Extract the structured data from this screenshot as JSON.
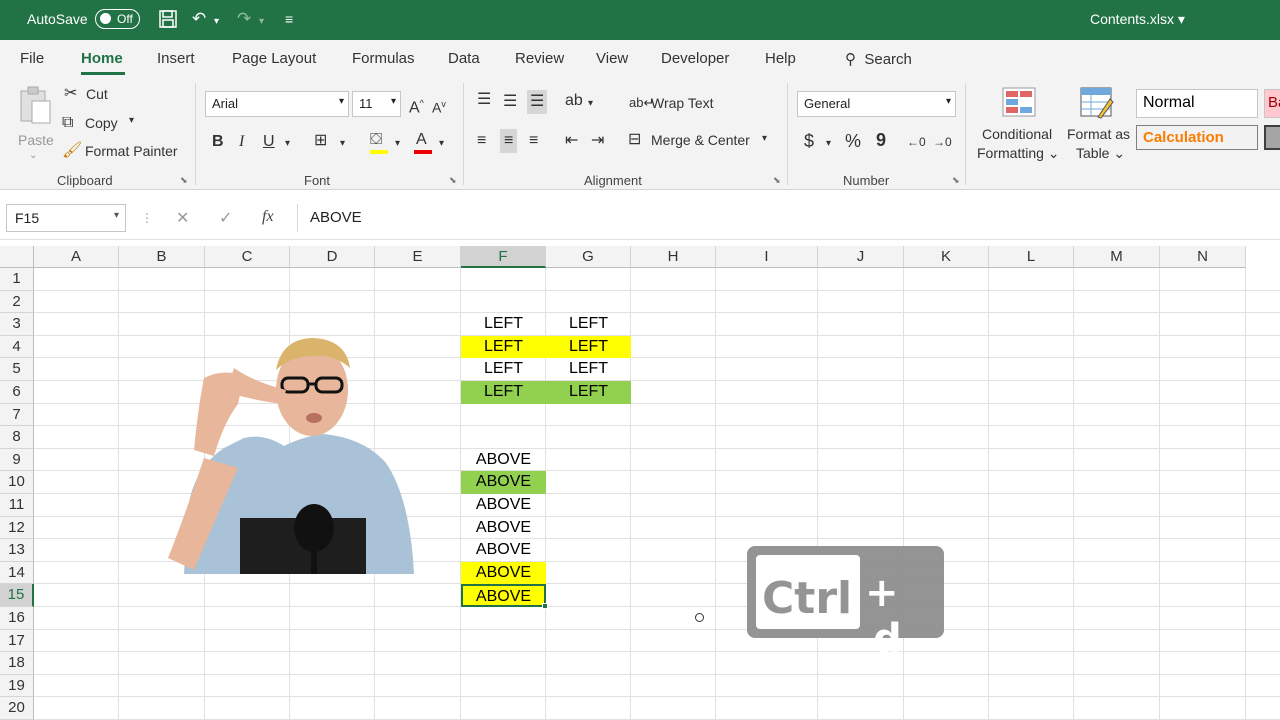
{
  "titlebar": {
    "autosave_label": "AutoSave",
    "toggle_state": "Off",
    "filename": "Contents.xlsx"
  },
  "menu": {
    "items": [
      "File",
      "Home",
      "Insert",
      "Page Layout",
      "Formulas",
      "Data",
      "Review",
      "View",
      "Developer",
      "Help"
    ],
    "search": "Search",
    "active": "Home"
  },
  "ribbon": {
    "clipboard": {
      "paste": "Paste",
      "cut": "Cut",
      "copy": "Copy",
      "format_painter": "Format Painter",
      "label": "Clipboard"
    },
    "font": {
      "name": "Arial",
      "size": "11",
      "bold": "B",
      "italic": "I",
      "underline": "U",
      "label": "Font"
    },
    "alignment": {
      "wrap_text": "Wrap Text",
      "merge_center": "Merge & Center",
      "label": "Alignment"
    },
    "number": {
      "format": "General",
      "currency": "$",
      "percent": "%",
      "comma": "9",
      "label": "Number"
    },
    "styles": {
      "conditional": [
        "Conditional",
        "Formatting"
      ],
      "format_table": [
        "Format as",
        "Table"
      ],
      "normal": "Normal",
      "calculation": "Calculation",
      "bad": "Ba"
    }
  },
  "formula_bar": {
    "name_box": "F15",
    "cancel": "✕",
    "enter": "✓",
    "fx": "fx",
    "value": "ABOVE"
  },
  "sheet": {
    "columns": [
      "A",
      "B",
      "C",
      "D",
      "E",
      "F",
      "G",
      "H",
      "I",
      "J",
      "K",
      "L",
      "M",
      "N"
    ],
    "rows": [
      "1",
      "2",
      "3",
      "4",
      "5",
      "6",
      "7",
      "8",
      "9",
      "10",
      "11",
      "12",
      "13",
      "14",
      "15",
      "16",
      "17",
      "18",
      "19",
      "20"
    ],
    "selected_col": "F",
    "selected_row": "15",
    "cells": {
      "F3": "LEFT",
      "G3": "LEFT",
      "F4": "LEFT",
      "G4": "LEFT",
      "F5": "LEFT",
      "G5": "LEFT",
      "F6": "LEFT",
      "G6": "LEFT",
      "F9": "ABOVE",
      "F10": "ABOVE",
      "F11": "ABOVE",
      "F12": "ABOVE",
      "F13": "ABOVE",
      "F14": "ABOVE",
      "F15": "ABOVE"
    },
    "fill_colors": {
      "yellow": "#ffff00",
      "green": "#92d050"
    }
  },
  "shortcut_overlay": {
    "key1": "Ctrl",
    "plus": "+",
    "key2": "d"
  },
  "colors": {
    "accent": "#217346"
  }
}
